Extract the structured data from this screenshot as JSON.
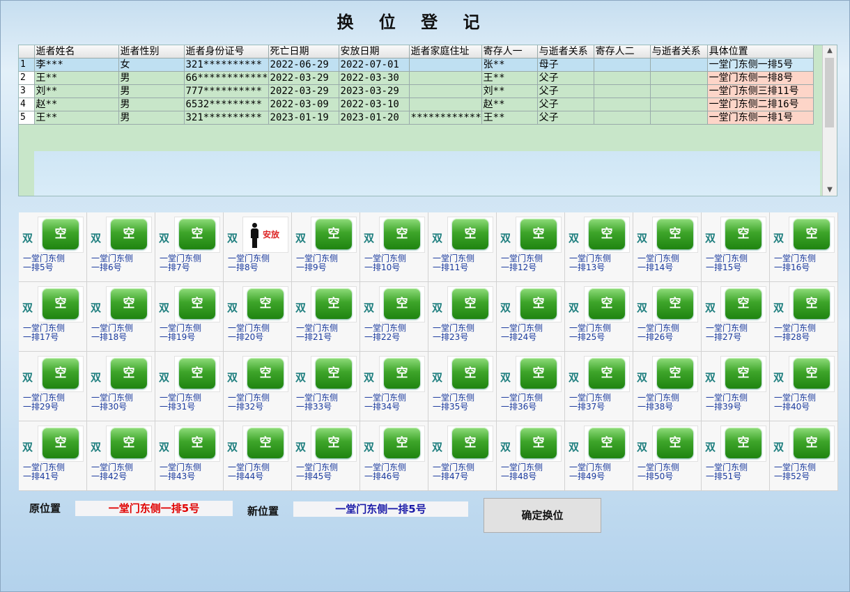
{
  "title": "换 位 登 记",
  "grid": {
    "columns": [
      "逝者姓名",
      "逝者性别",
      "逝者身份证号",
      "死亡日期",
      "安放日期",
      "逝者家庭住址",
      "寄存人一",
      "与逝者关系",
      "寄存人二",
      "与逝者关系",
      "具体位置"
    ],
    "rows": [
      {
        "num": "1",
        "cells": [
          "李***",
          "女",
          "321**********",
          "2022-06-29",
          "2022-07-01",
          "",
          "张**",
          "母子",
          "",
          "",
          "一堂门东侧一排5号"
        ]
      },
      {
        "num": "2",
        "cells": [
          "王**",
          "男",
          "66************",
          "2022-03-29",
          "2022-03-30",
          "",
          "王**",
          "父子",
          "",
          "",
          "一堂门东侧一排8号"
        ]
      },
      {
        "num": "3",
        "cells": [
          "刘**",
          "男",
          "777**********",
          "2022-03-29",
          "2023-03-29",
          "",
          "刘**",
          "父子",
          "",
          "",
          "一堂门东侧三排11号"
        ]
      },
      {
        "num": "4",
        "cells": [
          "赵**",
          "男",
          "6532*********",
          "2022-03-09",
          "2022-03-10",
          "",
          "赵**",
          "父子",
          "",
          "",
          "一堂门东侧二排16号"
        ]
      },
      {
        "num": "5",
        "cells": [
          "王**",
          "男",
          "321**********",
          "2023-01-19",
          "2023-01-20",
          "************",
          "王**",
          "父子",
          "",
          "",
          "一堂门东侧一排1号"
        ]
      }
    ]
  },
  "seat_panel": {
    "double_label": "双",
    "empty_label": "空",
    "occupied_label": "安放",
    "location_line1": "一堂门东侧",
    "seats": [
      {
        "num": "一排5号",
        "status": "empty"
      },
      {
        "num": "一排6号",
        "status": "empty"
      },
      {
        "num": "一排7号",
        "status": "empty"
      },
      {
        "num": "一排8号",
        "status": "occupied"
      },
      {
        "num": "一排9号",
        "status": "empty"
      },
      {
        "num": "一排10号",
        "status": "empty"
      },
      {
        "num": "一排11号",
        "status": "empty"
      },
      {
        "num": "一排12号",
        "status": "empty"
      },
      {
        "num": "一排13号",
        "status": "empty"
      },
      {
        "num": "一排14号",
        "status": "empty"
      },
      {
        "num": "一排15号",
        "status": "empty"
      },
      {
        "num": "一排16号",
        "status": "empty"
      },
      {
        "num": "一排17号",
        "status": "empty"
      },
      {
        "num": "一排18号",
        "status": "empty"
      },
      {
        "num": "一排19号",
        "status": "empty"
      },
      {
        "num": "一排20号",
        "status": "empty"
      },
      {
        "num": "一排21号",
        "status": "empty"
      },
      {
        "num": "一排22号",
        "status": "empty"
      },
      {
        "num": "一排23号",
        "status": "empty"
      },
      {
        "num": "一排24号",
        "status": "empty"
      },
      {
        "num": "一排25号",
        "status": "empty"
      },
      {
        "num": "一排26号",
        "status": "empty"
      },
      {
        "num": "一排27号",
        "status": "empty"
      },
      {
        "num": "一排28号",
        "status": "empty"
      },
      {
        "num": "一排29号",
        "status": "empty"
      },
      {
        "num": "一排30号",
        "status": "empty"
      },
      {
        "num": "一排31号",
        "status": "empty"
      },
      {
        "num": "一排32号",
        "status": "empty"
      },
      {
        "num": "一排33号",
        "status": "empty"
      },
      {
        "num": "一排34号",
        "status": "empty"
      },
      {
        "num": "一排35号",
        "status": "empty"
      },
      {
        "num": "一排36号",
        "status": "empty"
      },
      {
        "num": "一排37号",
        "status": "empty"
      },
      {
        "num": "一排38号",
        "status": "empty"
      },
      {
        "num": "一排39号",
        "status": "empty"
      },
      {
        "num": "一排40号",
        "status": "empty"
      },
      {
        "num": "一排41号",
        "status": "empty"
      },
      {
        "num": "一排42号",
        "status": "empty"
      },
      {
        "num": "一排43号",
        "status": "empty"
      },
      {
        "num": "一排44号",
        "status": "empty"
      },
      {
        "num": "一排45号",
        "status": "empty"
      },
      {
        "num": "一排46号",
        "status": "empty"
      },
      {
        "num": "一排47号",
        "status": "empty"
      },
      {
        "num": "一排48号",
        "status": "empty"
      },
      {
        "num": "一排49号",
        "status": "empty"
      },
      {
        "num": "一排50号",
        "status": "empty"
      },
      {
        "num": "一排51号",
        "status": "empty"
      },
      {
        "num": "一排52号",
        "status": "empty"
      }
    ]
  },
  "form": {
    "original_label": "原位置",
    "original_value": "一堂门东侧一排5号",
    "new_label": "新位置",
    "new_value": "一堂门东侧一排5号",
    "confirm_label": "确定换位"
  },
  "colors": {
    "original_value": "#e00000",
    "new_value": "#1a1aa8",
    "grid_bg": "#c8e6c9",
    "empty_button": "#3ea52a"
  }
}
